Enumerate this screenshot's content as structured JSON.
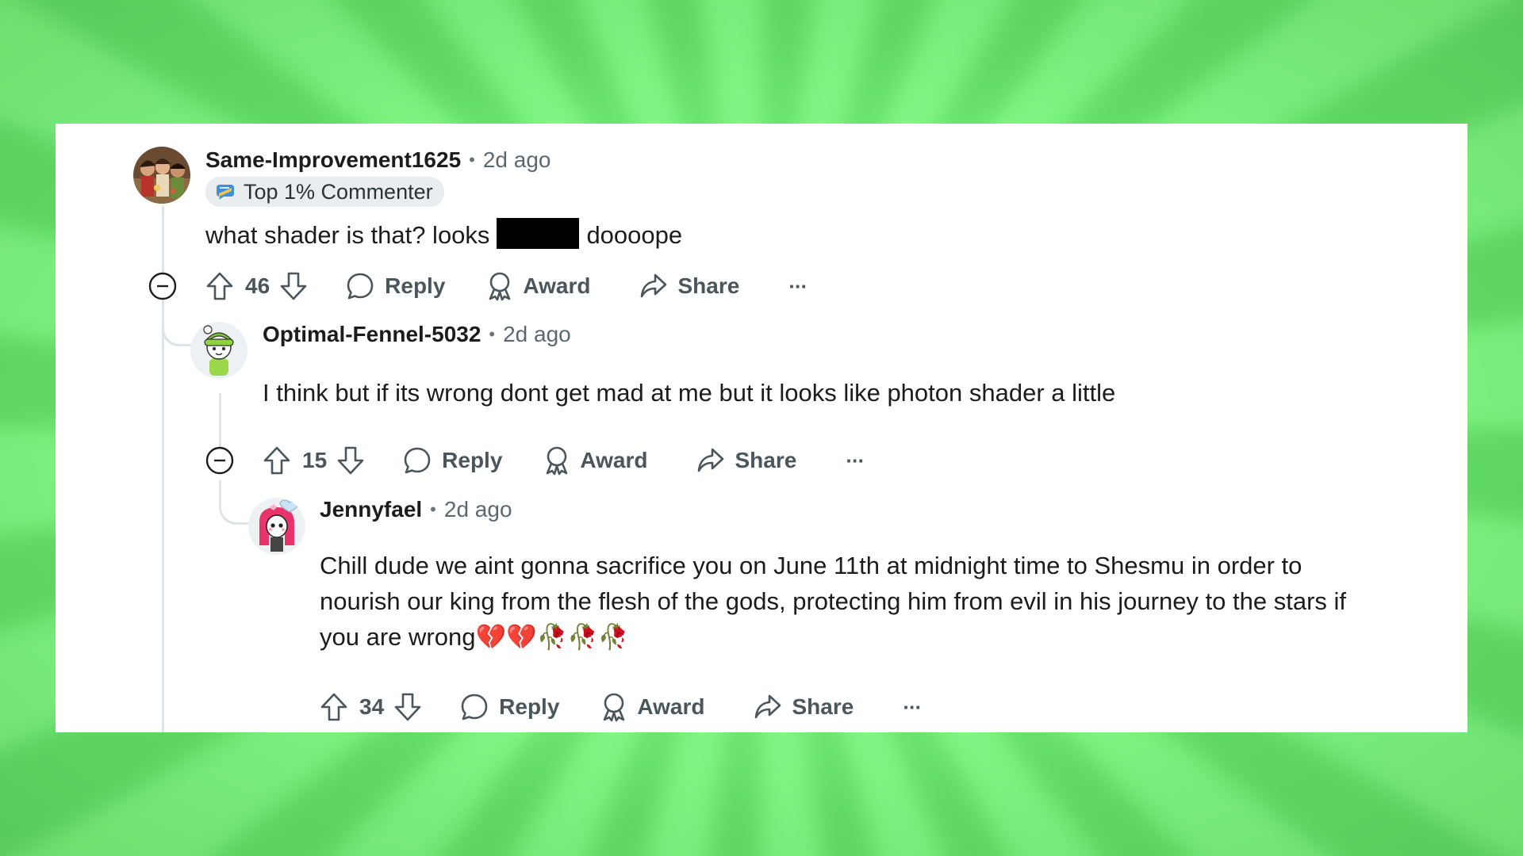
{
  "comments": [
    {
      "username": "Same-Improvement1625",
      "separator": "•",
      "time": "2d ago",
      "badge": "Top 1% Commenter",
      "text_before": "what shader is that? looks",
      "text_after": "doooope",
      "votes": "46",
      "reply_label": "Reply",
      "award_label": "Award",
      "share_label": "Share",
      "more_label": "···"
    },
    {
      "username": "Optimal-Fennel-5032",
      "separator": "•",
      "time": "2d ago",
      "text": "I think but if its wrong dont get mad at me but it looks like photon shader a little",
      "votes": "15",
      "reply_label": "Reply",
      "award_label": "Award",
      "share_label": "Share",
      "more_label": "···"
    },
    {
      "username": "Jennyfael",
      "separator": "•",
      "time": "2d ago",
      "text_line1": "Chill dude we aint gonna sacrifice you on June 11th at midnight time to Shesmu in order to",
      "text_line2": "nourish our king from the flesh of the gods, protecting him from evil in his journey to the stars if",
      "text_line3": "you are wrong💔💔🥀🥀🥀",
      "votes": "34",
      "reply_label": "Reply",
      "award_label": "Award",
      "share_label": "Share",
      "more_label": "···"
    }
  ],
  "colors": {
    "background_green": "#72ed75",
    "text": "#1c1c1c",
    "meta": "#5c6870",
    "action": "#4a555c",
    "thread_line": "#dfe3e6"
  }
}
